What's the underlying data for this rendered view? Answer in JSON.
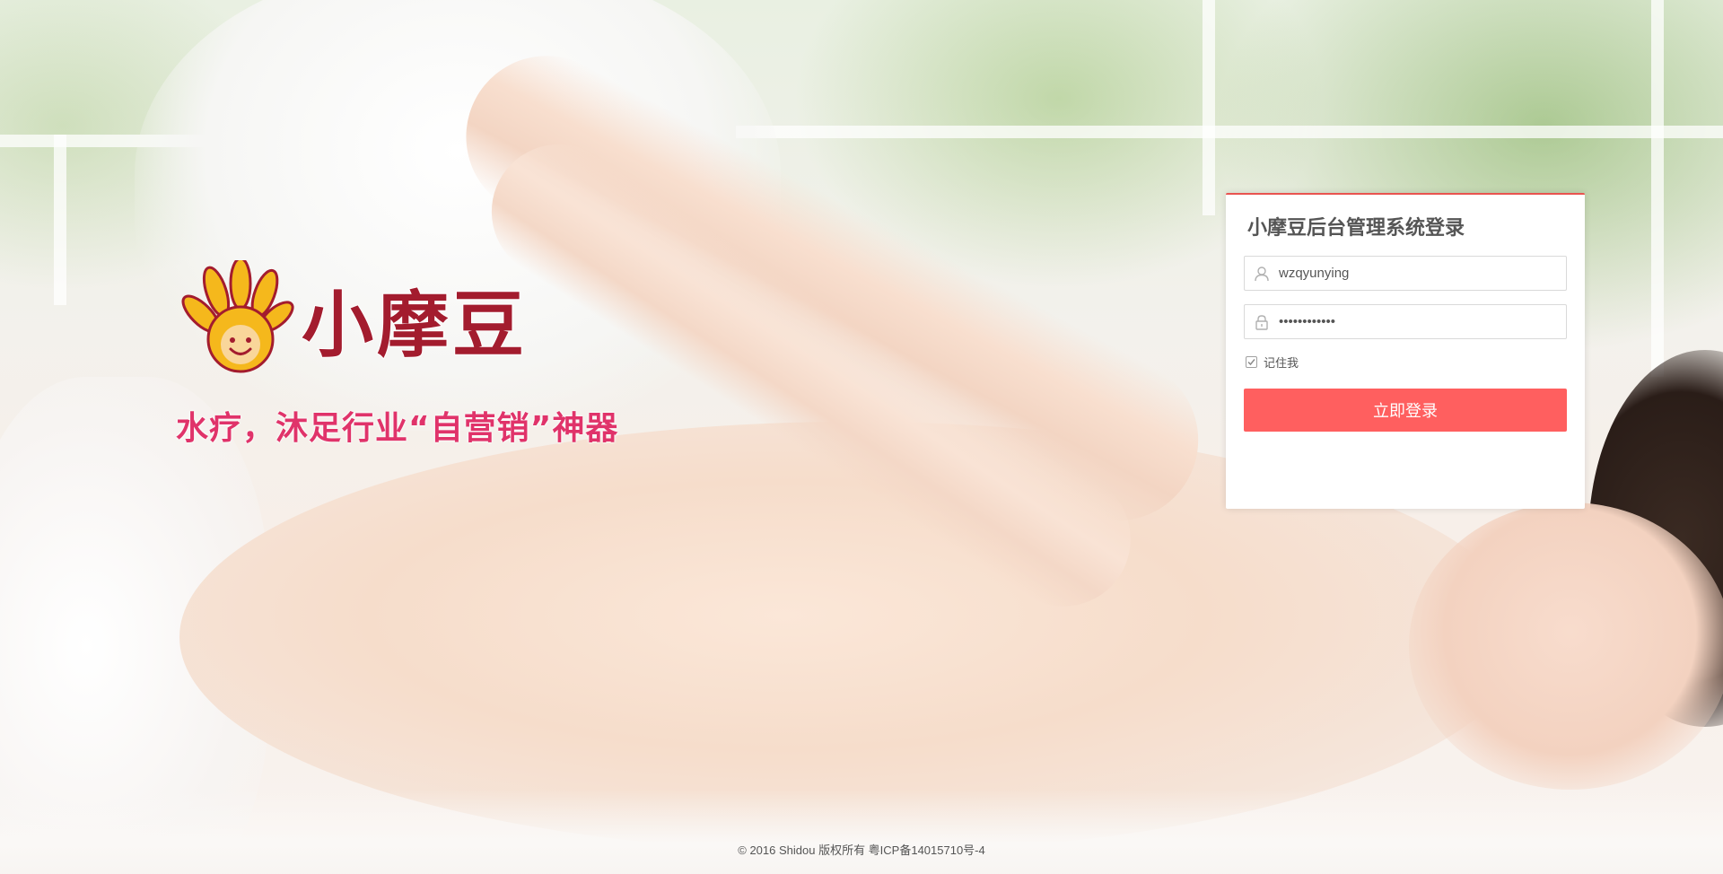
{
  "brand": {
    "name": "小摩豆",
    "slogan": "水疗，沐足行业“自营销”神器",
    "logo_icon": "smiling-hand-sun-icon",
    "colors": {
      "brand_red": "#a31c2e",
      "slogan_pink": "#e0336a",
      "logo_yellow": "#f5b81c"
    }
  },
  "login": {
    "title": "小摩豆后台管理系统登录",
    "username": {
      "value": "wzqyunying",
      "icon": "user-icon"
    },
    "password": {
      "value": "••••••••••••",
      "icon": "lock-icon"
    },
    "remember": {
      "label": "记住我",
      "checked": true
    },
    "submit_label": "立即登录",
    "accent_color": "#ff5f5f"
  },
  "footer": {
    "copyright": "© 2016 Shidou 版权所有 粤ICP备14015710号-4"
  }
}
